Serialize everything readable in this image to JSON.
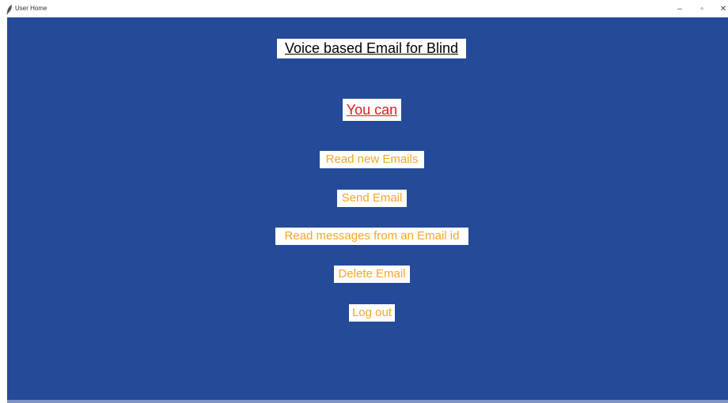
{
  "window": {
    "title": "User Home",
    "controls": {
      "minimize": "–",
      "maximize": "▫",
      "close": "✕"
    }
  },
  "main": {
    "heading": "Voice based Email for Blind",
    "subheading": "You can",
    "options": [
      {
        "label": "Read new Emails"
      },
      {
        "label": "Send Email"
      },
      {
        "label": "Read messages from an Email id"
      },
      {
        "label": "Delete Email"
      },
      {
        "label": "Log out"
      }
    ]
  },
  "colors": {
    "background": "#244a99",
    "heading_text": "#000000",
    "subheading_text": "#e01b1b",
    "option_text": "#f5a623"
  }
}
